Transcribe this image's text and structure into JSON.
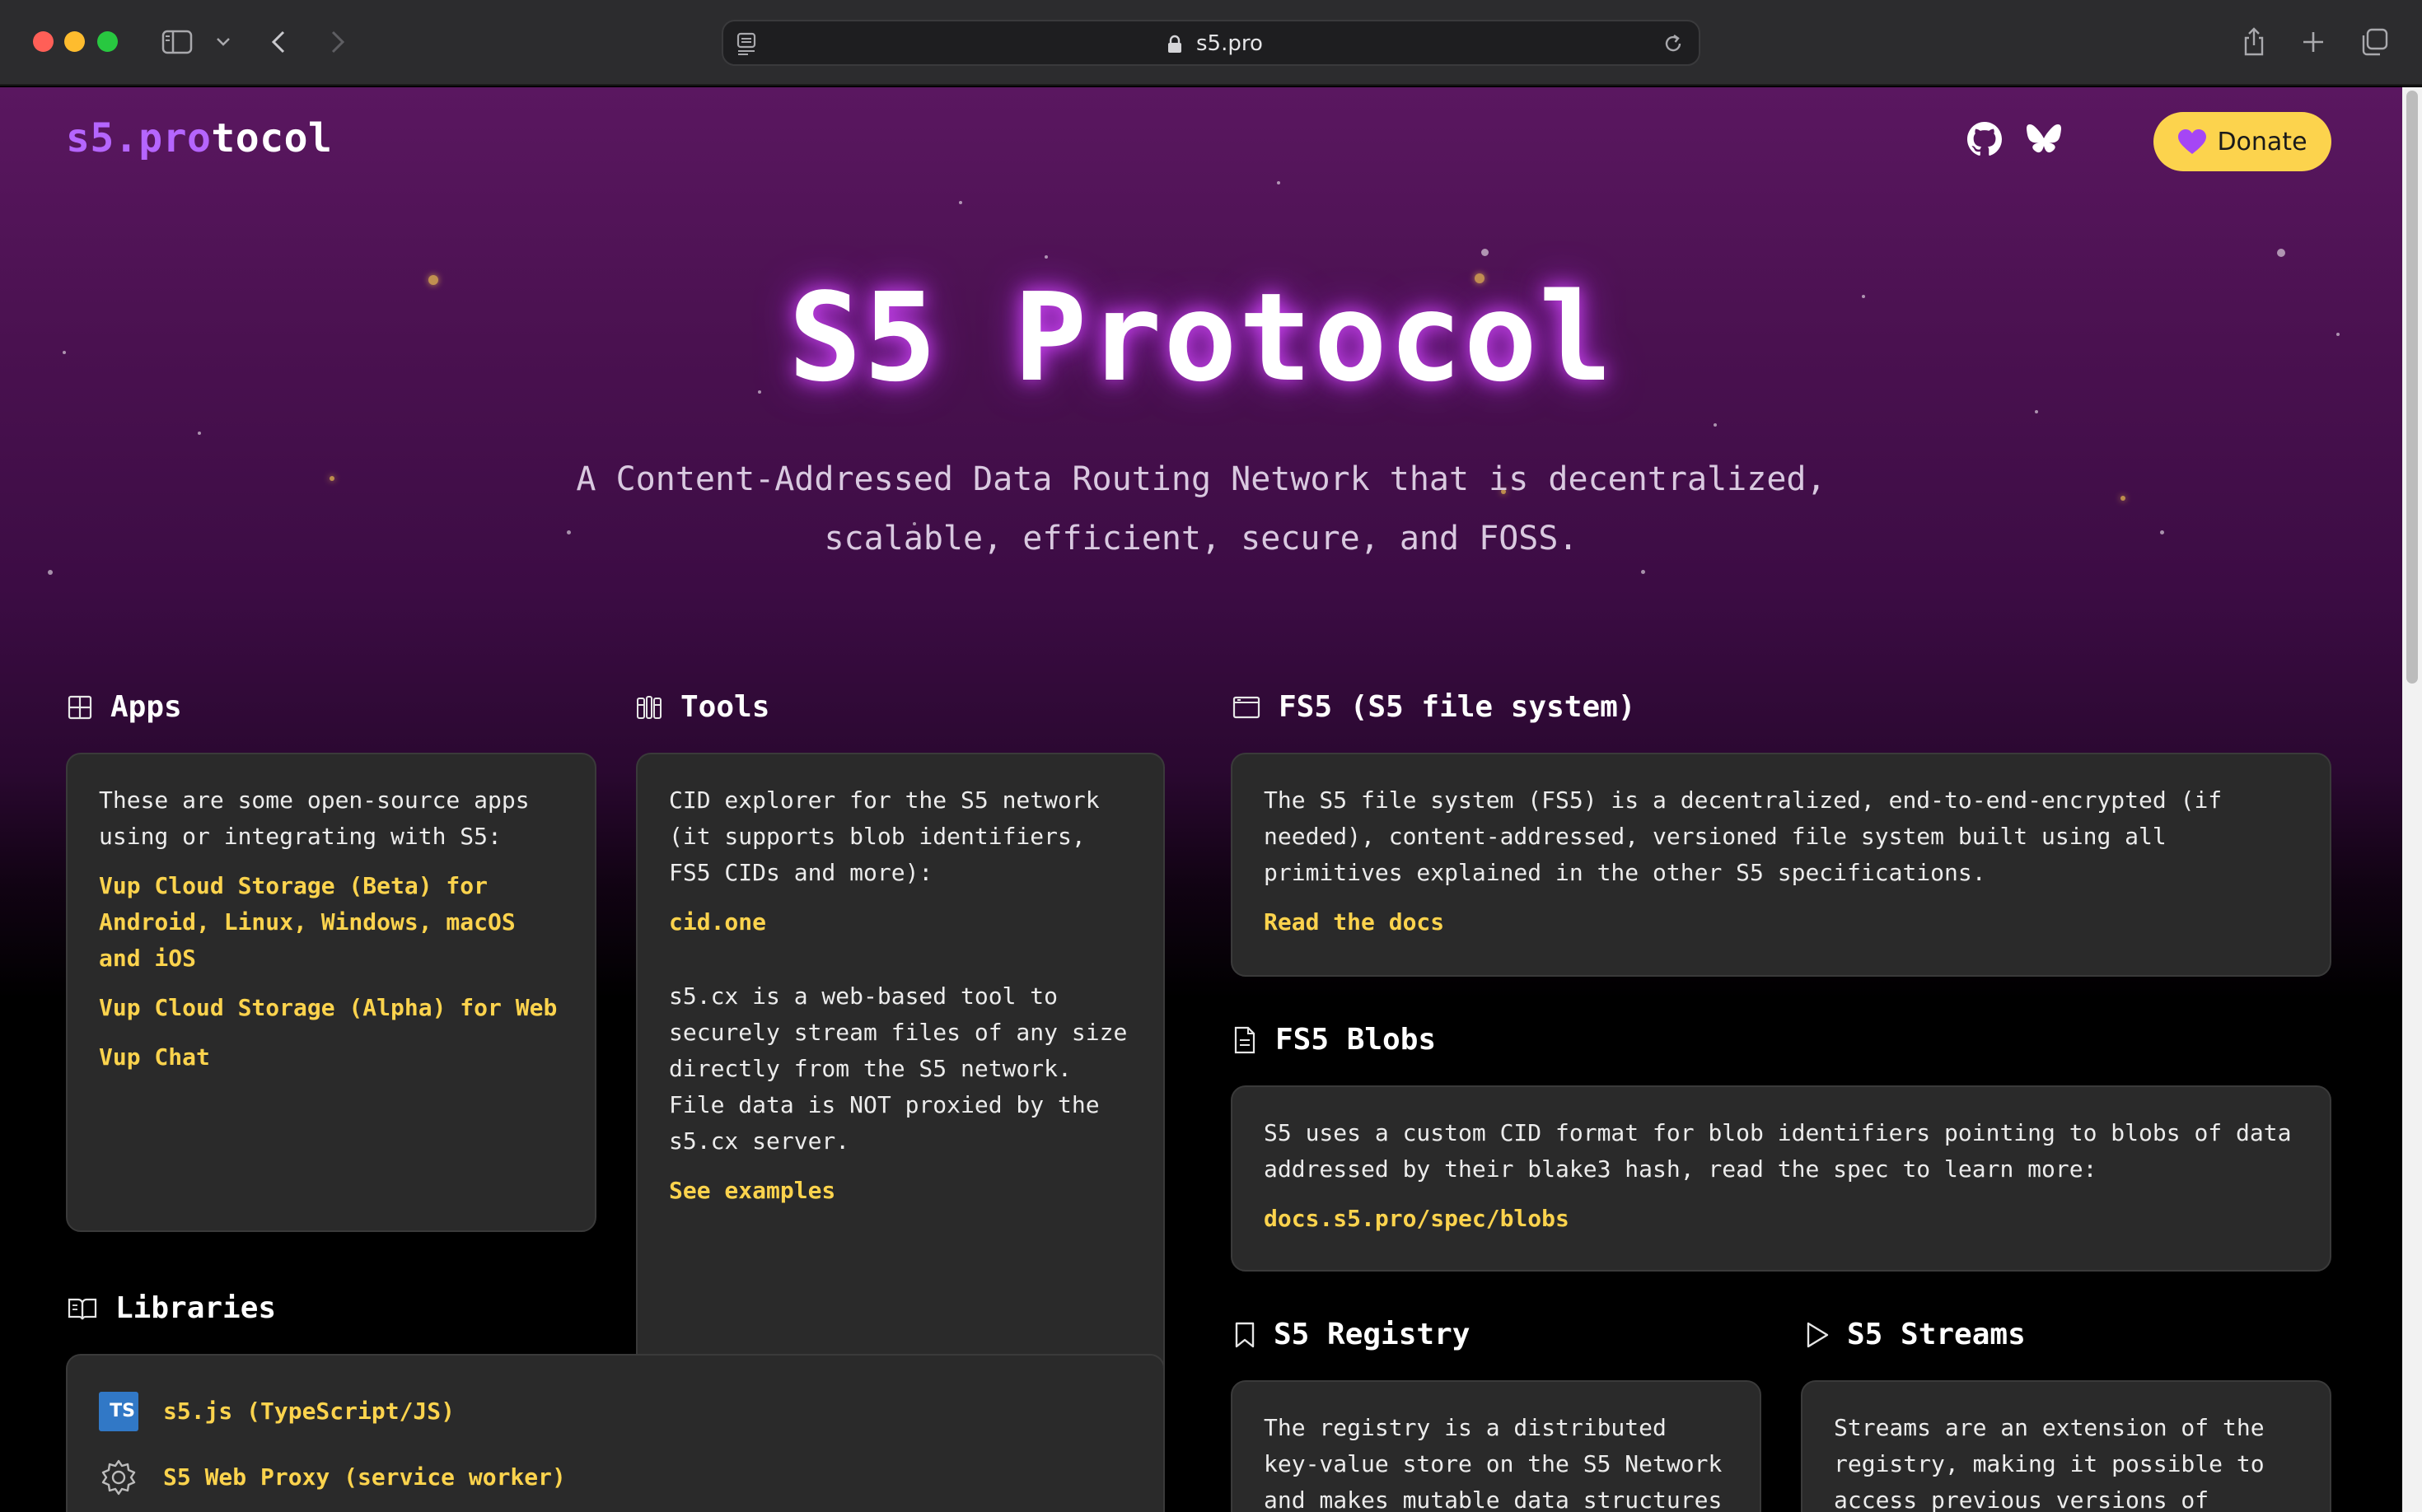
{
  "browser": {
    "url": "s5.pro",
    "icons": [
      "sidebar-icon",
      "chevron-down-icon",
      "back-icon",
      "forward-icon",
      "reader-icon",
      "lock-icon",
      "reload-icon",
      "share-icon",
      "new-tab-icon",
      "tabs-overview-icon"
    ]
  },
  "header": {
    "brand_part1": "s5.pro",
    "brand_part2": "tocol",
    "icons": [
      "github-icon",
      "bluesky-icon",
      "heart-icon"
    ],
    "donate_label": "Donate",
    "accent": "#b565ff",
    "donate_color": "#fcd34d"
  },
  "hero": {
    "title": "S5 Protocol",
    "subtitle_line1": "A Content-Addressed Data Routing Network that is decentralized,",
    "subtitle_line2": "scalable, efficient, secure, and FOSS."
  },
  "apps": {
    "title": "Apps",
    "icon": "grid-icon",
    "intro": "These are some open-source apps using or integrating with S5:",
    "links": [
      "Vup Cloud Storage (Beta) for Android, Linux, Windows, macOS and iOS",
      "Vup Cloud Storage (Alpha) for Web",
      "Vup Chat"
    ]
  },
  "tools": {
    "title": "Tools",
    "icon": "tools-icon",
    "cid_text": "CID explorer for the S5 network (it supports blob identifiers, FS5 CIDs and more):",
    "cid_link": "cid.one",
    "s5cx_text": "s5.cx is a web-based tool to securely stream files of any size directly from the S5 network. File data is NOT proxied by the s5.cx server.",
    "s5cx_link": "See examples"
  },
  "fs5": {
    "title": "FS5 (S5 file system)",
    "icon": "window-icon",
    "text": "The S5 file system (FS5) is a decentralized, end-to-end-encrypted (if needed), content-addressed, versioned file system built using all primitives explained in the other S5 specifications.",
    "link": "Read the docs"
  },
  "blobs": {
    "title": "FS5 Blobs",
    "icon": "file-icon",
    "text": "S5 uses a custom CID format for blob identifiers pointing to blobs of data addressed by their blake3 hash, read the spec to learn more:",
    "link": "docs.s5.pro/spec/blobs"
  },
  "libraries": {
    "title": "Libraries",
    "icon": "book-icon",
    "items": [
      {
        "label": "s5.js (TypeScript/JS)",
        "badge": "TS",
        "icon": "typescript-icon"
      },
      {
        "label": "S5 Web Proxy (service worker)",
        "icon": "gear-icon"
      }
    ]
  },
  "registry": {
    "title": "S5 Registry",
    "icon": "bookmark-icon",
    "text": "The registry is a distributed key-value store on the S5 Network and makes mutable data structures"
  },
  "streams": {
    "title": "S5 Streams",
    "icon": "play-icon",
    "text": "Streams are an extension of the registry, making it possible to access previous versions of"
  }
}
